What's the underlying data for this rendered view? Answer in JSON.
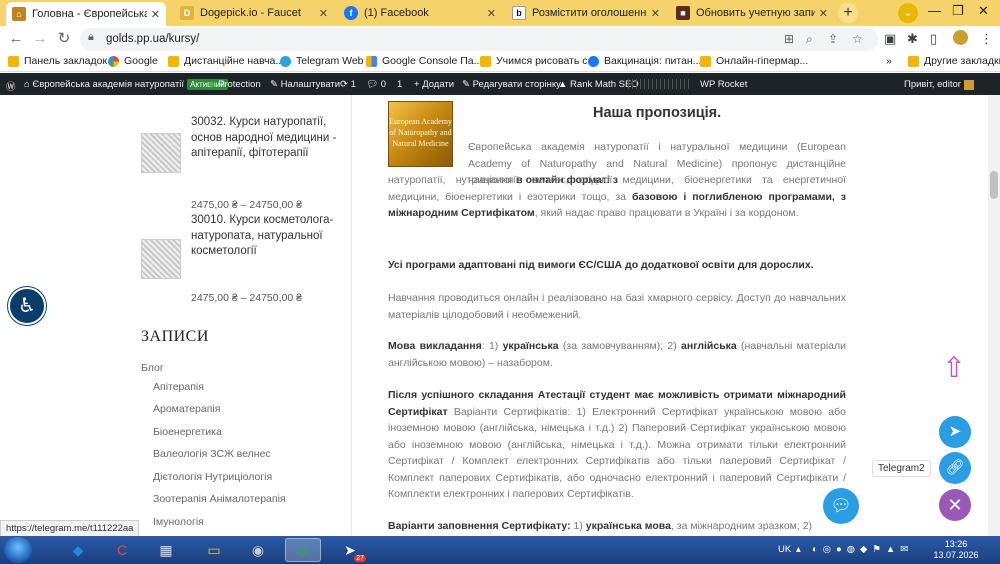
{
  "tabs": [
    {
      "title": "Головна - Європейська акаде",
      "icon": "home",
      "color": "#c0841f",
      "active": true
    },
    {
      "title": "Dogepick.io - Faucet",
      "icon": "doge",
      "color": "#e2b33c",
      "active": false
    },
    {
      "title": "(1) Facebook",
      "icon": "facebook",
      "color": "#1877f2",
      "active": false
    },
    {
      "title": "Розмістити оголошення безк",
      "icon": "b-logo",
      "color": "#222222",
      "active": false
    },
    {
      "title": "Обновить учетную запись",
      "icon": "account",
      "color": "#5a2c1a",
      "active": false
    }
  ],
  "browser": {
    "url": "golds.pp.ua/kursy/"
  },
  "bookmarks": [
    {
      "label": "Панель закладок",
      "type": "folder"
    },
    {
      "label": "Google",
      "type": "google"
    },
    {
      "label": "Дистанційне навча...",
      "type": "folder"
    },
    {
      "label": "Telegram Web",
      "type": "telegram"
    },
    {
      "label": "Google Console Па...",
      "type": "console"
    },
    {
      "label": "Учимся рисовать с...",
      "type": "folder"
    },
    {
      "label": "Вакцинація: питан...",
      "type": "facebook"
    },
    {
      "label": "Онлайн-гіпермар...",
      "type": "folder"
    },
    {
      "label": "Другие закладки",
      "type": "folder"
    }
  ],
  "wpbar": {
    "site": "Європейська академія натуропатії",
    "badge": "Активний",
    "protection": "Protection",
    "settings": "Налаштувати",
    "updates": "1",
    "comments": "0",
    "comments2": "1",
    "add": "Додати",
    "edit": "Редагувати сторінку",
    "seo": "Rank Math SEO",
    "rocket": "WP Rocket",
    "greeting": "Привіт, editor"
  },
  "sidebar": {
    "products": [
      {
        "name": "30032. Курси натуропатії, основ народної медицини - апітерапії, фітотерапії",
        "price": "2475,00 ₴ – 24750,00 ₴"
      },
      {
        "name": "30010. Курси косметолога-натуропата, натуральної косметології",
        "price": "2475,00 ₴ – 24750,00 ₴"
      }
    ],
    "heading": "ЗАПИСИ",
    "blog": "Блог",
    "categories": [
      "Апітерапія",
      "Ароматерапія",
      "Біоенергетика",
      "Валеологія ЗСЖ велнес",
      "Дієтологія Нутриціологія",
      "Зоотерапія Анімалотерапія",
      "Імунологія"
    ]
  },
  "content": {
    "logo_text": "European Academy of Naturopathy and Natural Medicine",
    "title": "Наша пропозиція.",
    "p1a": "Європейська академія натуропатії і натуральної медицини (European Academy of Naturopathy and Natural Medicine) пропонує дистанційне навчання ",
    "p1b": "в онлайн форматі з",
    "p1c": " натуропатії, нутриціології, велнес, східної медицини, біоенергетики та енергетичної медицини, біоенергетики і езотерики тощо, за ",
    "p1d": "базовою і поглибленою програмами, з міжнародним Сертифікатом",
    "p1e": ", який надає право працювати в Україні і за кордоном.",
    "p2": "Усі програми адаптовані під вимоги ЄС/США до додаткової освіти для дорослих.",
    "p3": "Навчання проводиться онлайн і реалізовано на базі хмарного сервісу. Доступ до навчальних матеріалів цілодобовий і необмежений.",
    "p4a": "Мова викладання",
    "p4b": ": 1) ",
    "p4c": "українська",
    "p4d": " (за замовчуванням); 2) ",
    "p4e": "англійська",
    "p4f": " (навчальні матеріали англійською мовою) – назабором.",
    "p5a": "Після успішного складання Атестації студент має можливість отримати міжнародний Сертифікат",
    "p5b": " Варіанти Сертифікатів: 1) Електронний Сертифікат українською мовою або іноземною мовою (англійська, німецька і т.д.) 2) Паперовий Сертифікат українською мовою або іноземною мовою (англійська, німецька і т.д.). Можна отримати тільки електронний Сертифікат / Комплект електронних Сертифікатів або тільки паперовий Сертифікат / Комплект паперових Сертифікатів, або одночасно електронний і паперовий Сертифікати / Комплекти електронних і паперових Сертифікатів.",
    "p6a": "Варіанти заповнення Сертифікату:",
    "p6b": " 1) ",
    "p6c": "українська мова",
    "p6d": ", за міжнародним зразком; 2)"
  },
  "widgets": {
    "telegram_label": "Telegram2",
    "status_url": "https://telegram.me/t111222aa"
  },
  "taskbar": {
    "lang": "UK",
    "time": "13:26",
    "date": "13.07.2026",
    "telegram_badge": "27"
  },
  "colors": {
    "tabstrip": "#f6d36a",
    "wpbar": "#1d2327",
    "accent_purple": "#9b59b6",
    "telegram_blue": "#2a9de3"
  }
}
